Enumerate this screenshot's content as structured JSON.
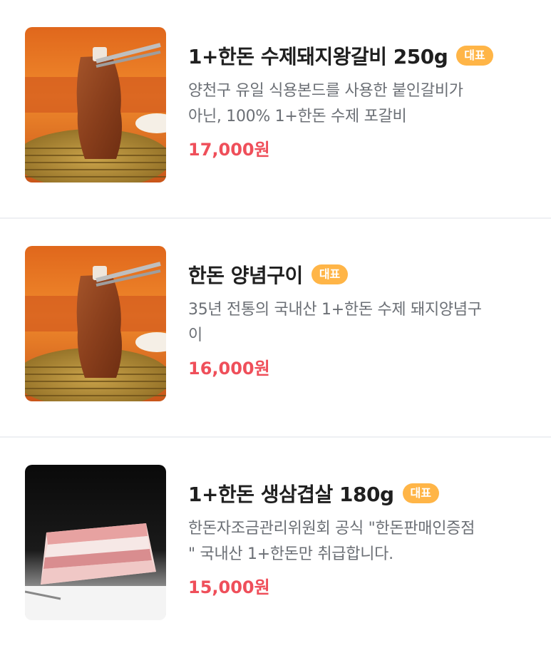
{
  "colors": {
    "badge": "#ffb547",
    "price": "#ef4f5a",
    "divider": "#eef0f3"
  },
  "menu_items": [
    {
      "image_icon": "grilled-galbi-photo",
      "title": "1+한돈 수제돼지왕갈비 250g",
      "badge": "대표",
      "desc_line1": "양천구 유일 식용본드를 사용한 붙인갈비가",
      "desc_line2": "아닌, 100% 1+한돈 수제 포갈비",
      "price": "17,000원"
    },
    {
      "image_icon": "grilled-galbi-photo",
      "title": "한돈 양념구이",
      "badge": "대표",
      "desc_line1": "35년 전통의 국내산 1+한돈 수제 돼지양념구",
      "desc_line2": "이",
      "price": "16,000원"
    },
    {
      "image_icon": "pork-belly-photo",
      "title": "1+한돈 생삼겹살 180g",
      "badge": "대표",
      "desc_line1": "한돈자조금관리위원회 공식 \"한돈판매인증점",
      "desc_line2": "\" 국내산 1+한돈만 취급합니다.",
      "price": "15,000원"
    }
  ]
}
